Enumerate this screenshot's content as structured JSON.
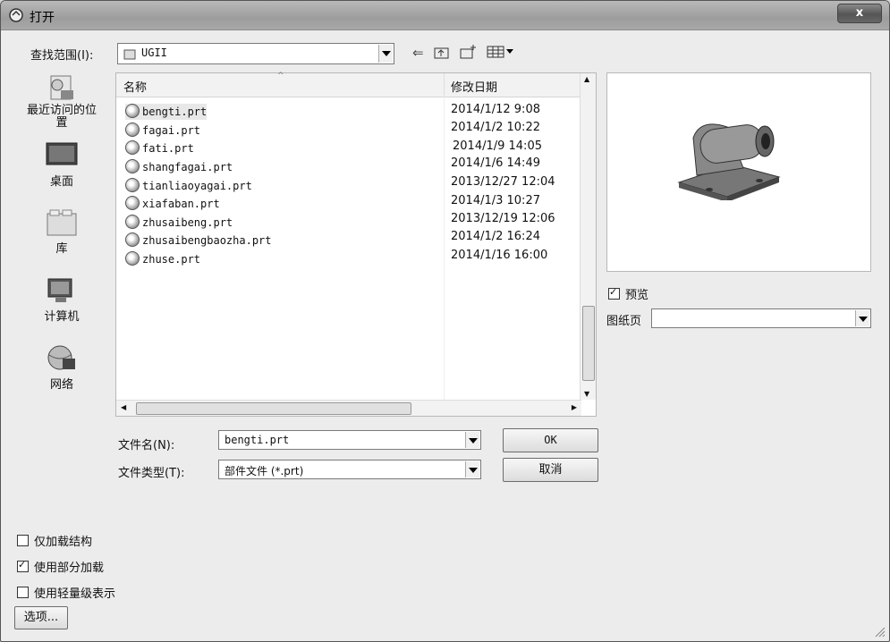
{
  "window": {
    "title": "打开",
    "close_label": "x"
  },
  "lookin": {
    "label": "查找范围(I):",
    "value": "UGII"
  },
  "places": [
    {
      "label": "最近访问的位置",
      "icon": "recent-places-icon"
    },
    {
      "label": "桌面",
      "icon": "desktop-icon"
    },
    {
      "label": "库",
      "icon": "library-icon"
    },
    {
      "label": "计算机",
      "icon": "computer-icon"
    },
    {
      "label": "网络",
      "icon": "network-icon"
    }
  ],
  "columns": {
    "name": "名称",
    "date": "修改日期"
  },
  "files": [
    {
      "name": "bengti.prt",
      "date": "2014/1/12 9:08"
    },
    {
      "name": "fagai.prt",
      "date": "2014/1/2 10:22"
    },
    {
      "name": "fati.prt",
      "date": "2014/1/9 14:05"
    },
    {
      "name": "shangfagai.prt",
      "date": "2014/1/6 14:49"
    },
    {
      "name": "tianliaoyagai.prt",
      "date": "2013/12/27 12:04"
    },
    {
      "name": "xiafaban.prt",
      "date": "2014/1/3 10:27"
    },
    {
      "name": "zhusaibeng.prt",
      "date": "2013/12/19 12:06"
    },
    {
      "name": "zhusaibengbaozha.prt",
      "date": "2014/1/2 16:24"
    },
    {
      "name": "zhuse.prt",
      "date": "2014/1/16 16:00"
    }
  ],
  "filename": {
    "label": "文件名(N):",
    "value": "bengti.prt"
  },
  "filetype": {
    "label": "文件类型(T):",
    "value": "部件文件 (*.prt)"
  },
  "buttons": {
    "ok": "OK",
    "cancel": "取消",
    "options": "选项..."
  },
  "preview": {
    "checkbox_label": "预览",
    "checked": true,
    "sheet_label": "图纸页",
    "sheet_value": ""
  },
  "options": [
    {
      "label": "仅加载结构",
      "checked": false
    },
    {
      "label": "使用部分加载",
      "checked": true
    },
    {
      "label": "使用轻量级表示",
      "checked": false
    }
  ]
}
